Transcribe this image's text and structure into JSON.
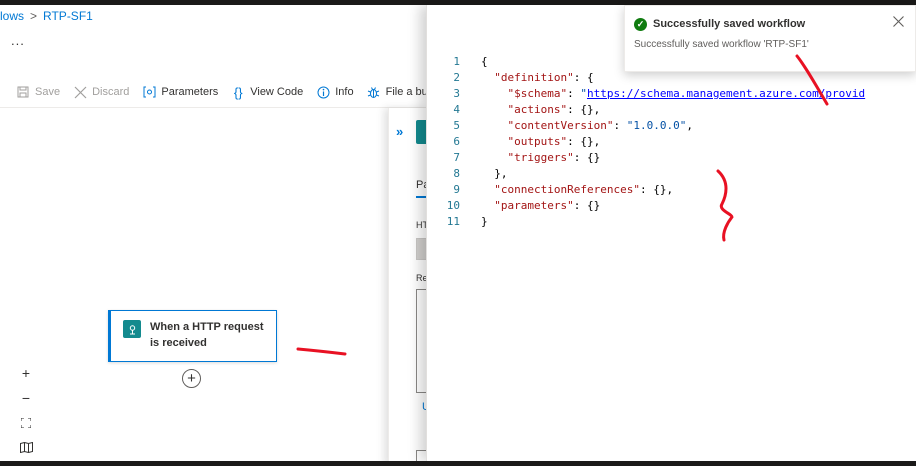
{
  "breadcrumb": {
    "parent": "lows",
    "separator": ">",
    "current": "RTP-SF1"
  },
  "header": {
    "more": "..."
  },
  "toolbar": {
    "save": "Save",
    "discard": "Discard",
    "parameters": "Parameters",
    "view_code": "View Code",
    "info": "Info",
    "file_bug": "File a bug"
  },
  "canvas": {
    "trigger_label": "When a HTTP request is received",
    "add_step": "+",
    "zoom_in": "+",
    "zoom_out": "−"
  },
  "side_panel": {
    "chevron": "»",
    "tab_partial": "Pa",
    "field_partial": "HT",
    "field2_partial": "Re",
    "link_partial": "U"
  },
  "code": {
    "line_numbers": [
      "1",
      "2",
      "3",
      "4",
      "5",
      "6",
      "7",
      "8",
      "9",
      "10",
      "11"
    ],
    "schema_url": "https://schema.management.azure.com/provid",
    "content_version": "1.0.0.0"
  },
  "toast": {
    "title": "Successfully saved workflow",
    "message": "Successfully saved workflow 'RTP-SF1'"
  },
  "colors": {
    "accent": "#0078d4",
    "success": "#107c10",
    "annotation": "#e81123"
  }
}
